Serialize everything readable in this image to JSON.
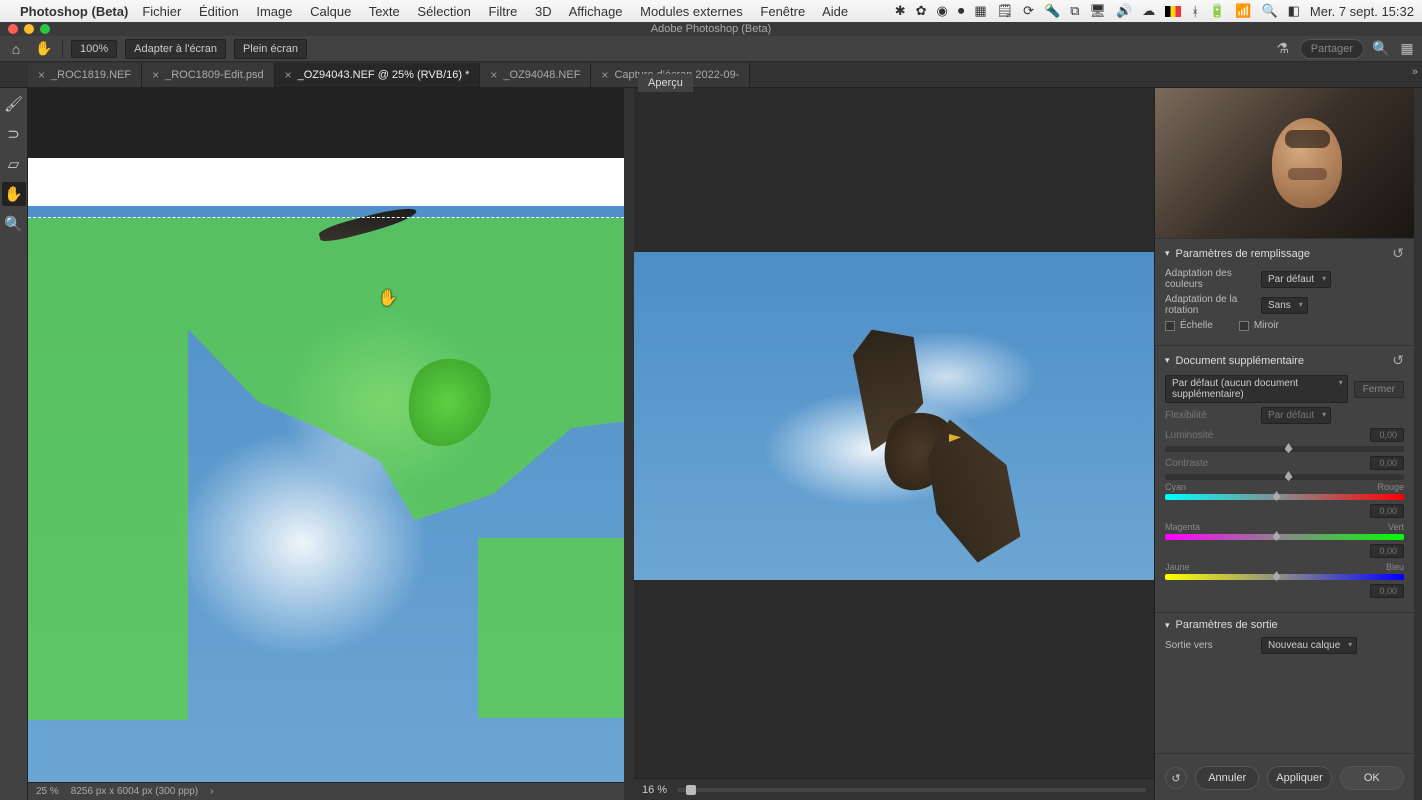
{
  "menubar": {
    "app_name": "Photoshop (Beta)",
    "menus": [
      "Fichier",
      "Édition",
      "Image",
      "Calque",
      "Texte",
      "Sélection",
      "Filtre",
      "3D",
      "Affichage",
      "Modules externes",
      "Fenêtre",
      "Aide"
    ],
    "clock": "Mer. 7 sept.  15:32"
  },
  "window_title": "Adobe Photoshop (Beta)",
  "options": {
    "zoom": "100%",
    "fit_screen": "Adapter à l'écran",
    "full_screen": "Plein écran",
    "share": "Partager"
  },
  "tabs": [
    {
      "label": "_ROC1819.NEF",
      "active": false
    },
    {
      "label": "_ROC1809-Edit.psd",
      "active": false
    },
    {
      "label": "_OZ94043.NEF @ 25% (RVB/16) *",
      "active": true
    },
    {
      "label": "_OZ94048.NEF",
      "active": false
    },
    {
      "label": "Capture d'écran 2022-09-",
      "active": false
    }
  ],
  "status": {
    "zoom": "25 %",
    "dims": "8256 px x 6004 px (300 ppp)"
  },
  "preview": {
    "tab_label": "Aperçu",
    "zoom": "16 %"
  },
  "panel": {
    "s1": {
      "title": "Paramètres de remplissage",
      "colorAdapt_label": "Adaptation des couleurs",
      "colorAdapt_value": "Par défaut",
      "rotAdapt_label": "Adaptation de la rotation",
      "rotAdapt_value": "Sans",
      "cb_scale": "Échelle",
      "cb_mirror": "Miroir"
    },
    "s2": {
      "title": "Document supplémentaire",
      "doc_value": "Par défaut (aucun document supplémentaire)",
      "close": "Fermer",
      "flex_label": "Flexibilité",
      "flex_value": "Par défaut",
      "lum": "Luminosité",
      "con": "Contraste",
      "cyan": "Cyan",
      "rouge": "Rouge",
      "magenta": "Magenta",
      "vert": "Vert",
      "jaune": "Jaune",
      "bleu": "Bleu",
      "zero": "0,00"
    },
    "s3": {
      "title": "Paramètres de sortie",
      "out_label": "Sortie vers",
      "out_value": "Nouveau calque"
    },
    "btns": {
      "cancel": "Annuler",
      "apply": "Appliquer",
      "ok": "OK"
    }
  }
}
